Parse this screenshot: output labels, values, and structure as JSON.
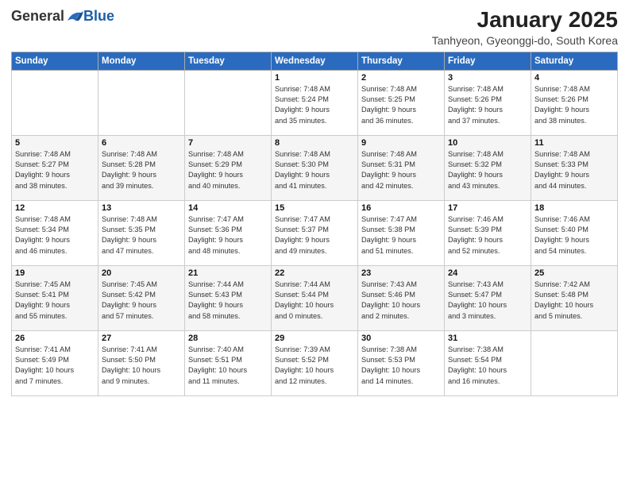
{
  "header": {
    "logo_general": "General",
    "logo_blue": "Blue",
    "title": "January 2025",
    "subtitle": "Tanhyeon, Gyeonggi-do, South Korea"
  },
  "calendar": {
    "days_of_week": [
      "Sunday",
      "Monday",
      "Tuesday",
      "Wednesday",
      "Thursday",
      "Friday",
      "Saturday"
    ],
    "weeks": [
      [
        {
          "day": "",
          "info": ""
        },
        {
          "day": "",
          "info": ""
        },
        {
          "day": "",
          "info": ""
        },
        {
          "day": "1",
          "info": "Sunrise: 7:48 AM\nSunset: 5:24 PM\nDaylight: 9 hours\nand 35 minutes."
        },
        {
          "day": "2",
          "info": "Sunrise: 7:48 AM\nSunset: 5:25 PM\nDaylight: 9 hours\nand 36 minutes."
        },
        {
          "day": "3",
          "info": "Sunrise: 7:48 AM\nSunset: 5:26 PM\nDaylight: 9 hours\nand 37 minutes."
        },
        {
          "day": "4",
          "info": "Sunrise: 7:48 AM\nSunset: 5:26 PM\nDaylight: 9 hours\nand 38 minutes."
        }
      ],
      [
        {
          "day": "5",
          "info": "Sunrise: 7:48 AM\nSunset: 5:27 PM\nDaylight: 9 hours\nand 38 minutes."
        },
        {
          "day": "6",
          "info": "Sunrise: 7:48 AM\nSunset: 5:28 PM\nDaylight: 9 hours\nand 39 minutes."
        },
        {
          "day": "7",
          "info": "Sunrise: 7:48 AM\nSunset: 5:29 PM\nDaylight: 9 hours\nand 40 minutes."
        },
        {
          "day": "8",
          "info": "Sunrise: 7:48 AM\nSunset: 5:30 PM\nDaylight: 9 hours\nand 41 minutes."
        },
        {
          "day": "9",
          "info": "Sunrise: 7:48 AM\nSunset: 5:31 PM\nDaylight: 9 hours\nand 42 minutes."
        },
        {
          "day": "10",
          "info": "Sunrise: 7:48 AM\nSunset: 5:32 PM\nDaylight: 9 hours\nand 43 minutes."
        },
        {
          "day": "11",
          "info": "Sunrise: 7:48 AM\nSunset: 5:33 PM\nDaylight: 9 hours\nand 44 minutes."
        }
      ],
      [
        {
          "day": "12",
          "info": "Sunrise: 7:48 AM\nSunset: 5:34 PM\nDaylight: 9 hours\nand 46 minutes."
        },
        {
          "day": "13",
          "info": "Sunrise: 7:48 AM\nSunset: 5:35 PM\nDaylight: 9 hours\nand 47 minutes."
        },
        {
          "day": "14",
          "info": "Sunrise: 7:47 AM\nSunset: 5:36 PM\nDaylight: 9 hours\nand 48 minutes."
        },
        {
          "day": "15",
          "info": "Sunrise: 7:47 AM\nSunset: 5:37 PM\nDaylight: 9 hours\nand 49 minutes."
        },
        {
          "day": "16",
          "info": "Sunrise: 7:47 AM\nSunset: 5:38 PM\nDaylight: 9 hours\nand 51 minutes."
        },
        {
          "day": "17",
          "info": "Sunrise: 7:46 AM\nSunset: 5:39 PM\nDaylight: 9 hours\nand 52 minutes."
        },
        {
          "day": "18",
          "info": "Sunrise: 7:46 AM\nSunset: 5:40 PM\nDaylight: 9 hours\nand 54 minutes."
        }
      ],
      [
        {
          "day": "19",
          "info": "Sunrise: 7:45 AM\nSunset: 5:41 PM\nDaylight: 9 hours\nand 55 minutes."
        },
        {
          "day": "20",
          "info": "Sunrise: 7:45 AM\nSunset: 5:42 PM\nDaylight: 9 hours\nand 57 minutes."
        },
        {
          "day": "21",
          "info": "Sunrise: 7:44 AM\nSunset: 5:43 PM\nDaylight: 9 hours\nand 58 minutes."
        },
        {
          "day": "22",
          "info": "Sunrise: 7:44 AM\nSunset: 5:44 PM\nDaylight: 10 hours\nand 0 minutes."
        },
        {
          "day": "23",
          "info": "Sunrise: 7:43 AM\nSunset: 5:46 PM\nDaylight: 10 hours\nand 2 minutes."
        },
        {
          "day": "24",
          "info": "Sunrise: 7:43 AM\nSunset: 5:47 PM\nDaylight: 10 hours\nand 3 minutes."
        },
        {
          "day": "25",
          "info": "Sunrise: 7:42 AM\nSunset: 5:48 PM\nDaylight: 10 hours\nand 5 minutes."
        }
      ],
      [
        {
          "day": "26",
          "info": "Sunrise: 7:41 AM\nSunset: 5:49 PM\nDaylight: 10 hours\nand 7 minutes."
        },
        {
          "day": "27",
          "info": "Sunrise: 7:41 AM\nSunset: 5:50 PM\nDaylight: 10 hours\nand 9 minutes."
        },
        {
          "day": "28",
          "info": "Sunrise: 7:40 AM\nSunset: 5:51 PM\nDaylight: 10 hours\nand 11 minutes."
        },
        {
          "day": "29",
          "info": "Sunrise: 7:39 AM\nSunset: 5:52 PM\nDaylight: 10 hours\nand 12 minutes."
        },
        {
          "day": "30",
          "info": "Sunrise: 7:38 AM\nSunset: 5:53 PM\nDaylight: 10 hours\nand 14 minutes."
        },
        {
          "day": "31",
          "info": "Sunrise: 7:38 AM\nSunset: 5:54 PM\nDaylight: 10 hours\nand 16 minutes."
        },
        {
          "day": "",
          "info": ""
        }
      ]
    ]
  }
}
